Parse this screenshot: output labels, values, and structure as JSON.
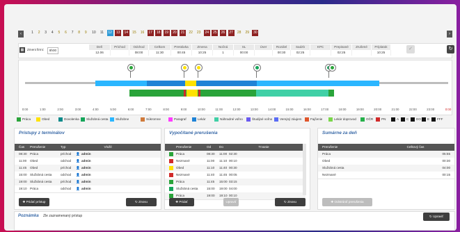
{
  "days": [
    "1",
    "2",
    "3",
    "4",
    "5",
    "6",
    "7",
    "8",
    "9",
    "10",
    "11",
    "12",
    "13",
    "14",
    "15",
    "16",
    "17",
    "18",
    "19",
    "20",
    "21",
    "22",
    "23",
    "24",
    "25",
    "26",
    "27",
    "28",
    "29",
    "30"
  ],
  "toolbar": {
    "label": "Zmeni firmi:",
    "value": "8h00"
  },
  "summary": {
    "headers": [
      "Deň",
      "Príchod",
      "Odchod",
      "Celkom",
      "Prestávka",
      "Zmena",
      "Nočná",
      "SL",
      "Úver",
      "Rozdiel",
      "Sadzb",
      "KPC",
      "Prepisané",
      "Zrušené",
      "Príplatok"
    ],
    "values": [
      "12.06",
      "",
      "08:00",
      "11:30",
      "00:45",
      "10:25",
      "1",
      "00:00",
      "",
      "00:30",
      "02:25",
      "",
      "02:25",
      "",
      "10:25"
    ]
  },
  "timeline": {
    "ticks": [
      "0:00",
      "1:00",
      "2:00",
      "3:00",
      "4:00",
      "5:00",
      "6:00",
      "7:00",
      "8:00",
      "9:00",
      "10:00",
      "11:00",
      "12:00",
      "13:00",
      "14:00",
      "15:00",
      "16:00",
      "17:00",
      "18:00",
      "19:00",
      "20:00",
      "21:00",
      "22:00",
      "23:00",
      "0:00"
    ]
  },
  "legend": [
    {
      "label": "Práca",
      "color": "#2aa43a"
    },
    {
      "label": "Obed",
      "color": "#ffe200"
    },
    {
      "label": "Dovolenka",
      "color": "#0a8a8a"
    },
    {
      "label": "Služobná cesta",
      "color": "#15a55a"
    },
    {
      "label": "Služobne",
      "color": "#2bb6ff"
    },
    {
      "label": "Súkromne",
      "color": "#d07a3b"
    },
    {
      "label": "Paragraf",
      "color": "#ff3cff"
    },
    {
      "label": "Lekár",
      "color": "#1f83d6"
    },
    {
      "label": "Náhradné voľno",
      "color": "#40d0a6"
    },
    {
      "label": "Študijné voľno",
      "color": "#6a5af0"
    },
    {
      "label": "Verejný záujem",
      "color": "#5a6cf5"
    },
    {
      "label": "Fajčenie",
      "color": "#e0562b"
    },
    {
      "label": "Lekár doprovod",
      "color": "#7ad64a"
    },
    {
      "label": "OČR",
      "color": "#26b04a"
    },
    {
      "label": "PN",
      "color": "#d12a2a"
    },
    {
      "label": "A",
      "color": "#111111"
    },
    {
      "label": "C",
      "color": "#111111"
    },
    {
      "label": "DO",
      "color": "#111111"
    },
    {
      "label": "E",
      "color": "#111111"
    },
    {
      "label": "FFF",
      "color": "#111111"
    }
  ],
  "access": {
    "title": "Prístupy z terminálov",
    "headers": [
      "Čas",
      "Prerušenie",
      "Typ",
      "Vložil"
    ],
    "rows": [
      [
        "08:30",
        "Práca",
        "príchod",
        "admin"
      ],
      [
        "11:00",
        "Obed",
        "odchod",
        "admin"
      ],
      [
        "11:45",
        "Obed",
        "príchod",
        "admin"
      ],
      [
        "15:00",
        "Služobná cesta",
        "odchod",
        "admin"
      ],
      [
        "19:00",
        "Služobná cesta",
        "príchod",
        "admin"
      ],
      [
        "19:10",
        "Práca",
        "odchod",
        "admin"
      ]
    ],
    "add": "Pridať prístup",
    "refresh": "Znovu"
  },
  "computed": {
    "title": "Vypočítané prerušenia",
    "headers": [
      "Prerušenie",
      "Od",
      "Do",
      "Trvanie"
    ],
    "rows": [
      {
        "c": "#2aa43a",
        "n": "Práca",
        "od": "08:30",
        "do": "11:00",
        "t": "02:30"
      },
      {
        "c": "#d12a2a",
        "n": "Nezmané",
        "od": "11:00",
        "do": "11:10",
        "t": "00:10"
      },
      {
        "c": "#ffe200",
        "n": "Obed",
        "od": "11:10",
        "do": "11:40",
        "t": "00:30"
      },
      {
        "c": "#d12a2a",
        "n": "Nezmané",
        "od": "11:40",
        "do": "11:45",
        "t": "00:05"
      },
      {
        "c": "#2aa43a",
        "n": "Práca",
        "od": "11:45",
        "do": "15:00",
        "t": "03:15"
      },
      {
        "c": "#15a55a",
        "n": "Služobná cesta",
        "od": "15:00",
        "do": "19:00",
        "t": "04:00"
      },
      {
        "c": "#2aa43a",
        "n": "Práca",
        "od": "19:00",
        "do": "19:10",
        "t": "00:10"
      }
    ],
    "add": "Pridať",
    "edit": "Upraviť",
    "refresh": "Znovu"
  },
  "totals": {
    "title": "Sumárne za deň",
    "headers": [
      "Prerušenie",
      "Celkový čas"
    ],
    "rows": [
      [
        "Práca",
        "05:55"
      ],
      [
        "Obed",
        "00:30"
      ],
      [
        "Služobná cesta",
        "04:00"
      ],
      [
        "Nezmané",
        "00:15"
      ]
    ],
    "button": "Odstrániť prerušenia"
  },
  "note": {
    "title": "Poznámka",
    "text": "Zle zaznamenaný prístup",
    "button": "Upraviť"
  }
}
